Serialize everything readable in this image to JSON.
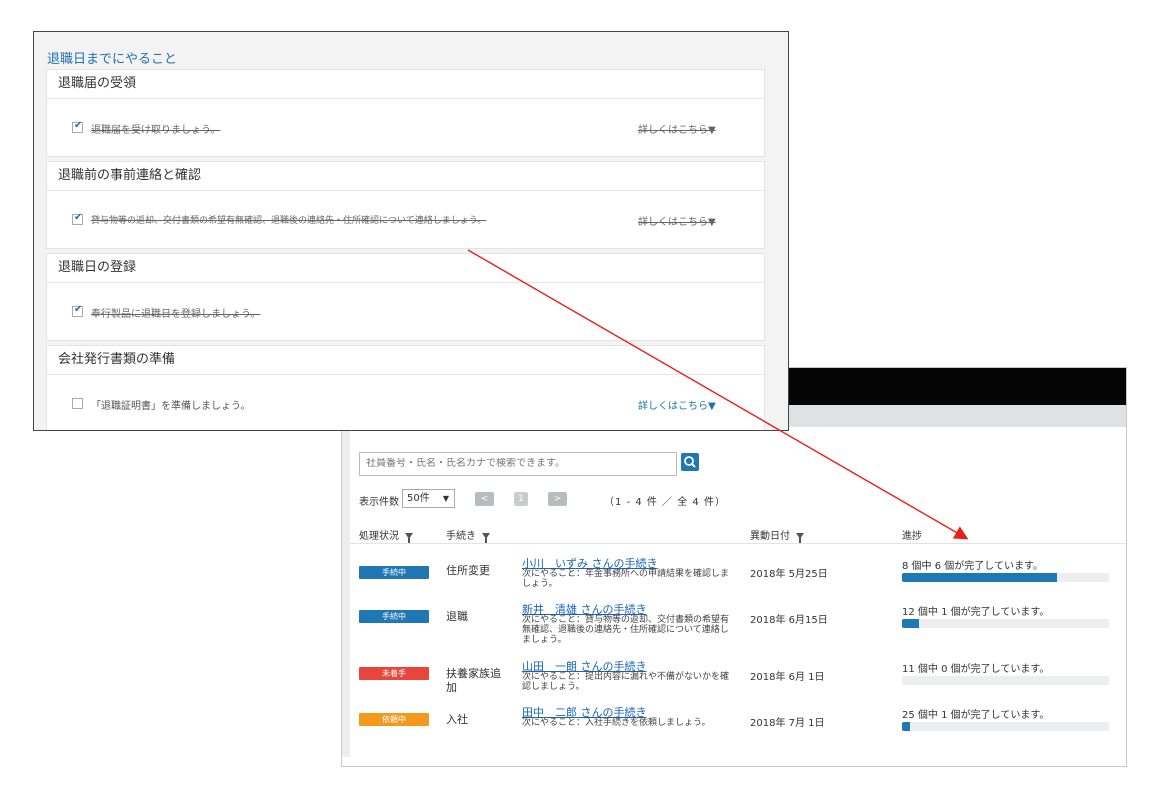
{
  "list": {
    "search_placeholder": "社員番号・氏名・氏名カナで検索できます。",
    "page_size_label": "表示件数",
    "page_size_value": "50件",
    "pager_prev": "<",
    "pager_page": "1",
    "pager_next": ">",
    "pager_info": "（1 - 4 件 ／ 全 4 件）",
    "columns": {
      "status": "処理状況",
      "procedure": "手続き",
      "date": "異動日付",
      "progress": "進捗"
    },
    "rows": [
      {
        "status": "手続中",
        "status_color": "#1f77b4",
        "procedure": "住所変更",
        "person": "小川　いずみ さんの手続き",
        "next": "次にやること：年金事務所への申請結果を確認しましょう。",
        "date": "2018年 5月25日",
        "progress_text": "8 個中 6 個が完了しています。",
        "progress_ratio": 0.75
      },
      {
        "status": "手続中",
        "status_color": "#1f77b4",
        "procedure": "退職",
        "person": "新井　清雄 さんの手続き",
        "next": "次にやること：貸与物等の返却、交付書類の希望有無確認、退職後の連絡先・住所確認について連絡しましょう。",
        "date": "2018年 6月15日",
        "progress_text": "12 個中 1 個が完了しています。",
        "progress_ratio": 0.0833
      },
      {
        "status": "未着手",
        "status_color": "#e8453c",
        "procedure": "扶養家族追加",
        "person": "山田　一朗 さんの手続き",
        "next": "次にやること：提出内容に漏れや不備がないかを確認しましょう。",
        "date": "2018年 6月 1日",
        "progress_text": "11 個中 0 個が完了しています。",
        "progress_ratio": 0
      },
      {
        "status": "依頼中",
        "status_color": "#f39a1e",
        "procedure": "入社",
        "person": "田中　二郎 さんの手続き",
        "next": "次にやること：入社手続きを依頼しましょう。",
        "date": "2018年 7月 1日",
        "progress_text": "25 個中 1 個が完了しています。",
        "progress_ratio": 0.04
      }
    ]
  },
  "checklist": {
    "title": "退職日までにやること",
    "sections": [
      {
        "heading": "退職届の受領",
        "task": "退職届を受け取りましょう。",
        "checked": true,
        "detail": "詳しくはこちら▼"
      },
      {
        "heading": "退職前の事前連絡と確認",
        "task": "貸与物等の返却、交付書類の希望有無確認、退職後の連絡先・住所確認について連絡しましょう。",
        "checked": true,
        "detail": "詳しくはこちら▼"
      },
      {
        "heading": "退職日の登録",
        "task": "奉行製品に退職日を登録しましょう。",
        "checked": true,
        "detail": ""
      },
      {
        "heading": "会社発行書類の準備",
        "task": "「退職証明書」を準備しましょう。",
        "checked": false,
        "detail": "詳しくはこちら▼"
      }
    ]
  },
  "colors": {
    "accent": "#1f6fb2",
    "arrow": "#e8201a"
  }
}
